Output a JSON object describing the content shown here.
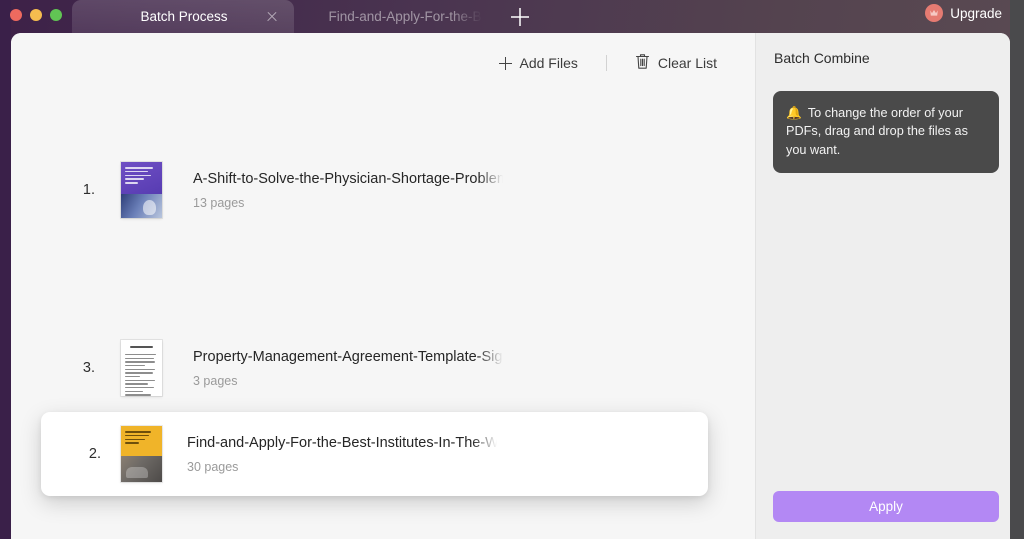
{
  "window": {
    "traffic_lights": [
      "close",
      "minimize",
      "zoom"
    ],
    "accent_purple": "#b388f4",
    "rail_purple": "#3a2049"
  },
  "tabs": [
    {
      "label": "Batch Process",
      "active": true,
      "closable": true
    },
    {
      "label": "Find-and-Apply-For-the-B",
      "active": false,
      "closable": false
    }
  ],
  "new_tab_label": "+",
  "upgrade": {
    "label": "Upgrade",
    "badge_color": "#e57b72"
  },
  "toolbar": {
    "add_files_label": "Add Files",
    "clear_list_label": "Clear List"
  },
  "files": [
    {
      "index": "1.",
      "name": "A-Shift-to-Solve-the-Physician-Shortage-Problem-ar",
      "pages": "13 pages",
      "thumb": "purple-research-cover",
      "dragging": false
    },
    {
      "index": "3.",
      "name": "Property-Management-Agreement-Template-Signatur",
      "pages": "3 pages",
      "thumb": "white-document-cover",
      "dragging": false
    },
    {
      "index": "2.",
      "name": "Find-and-Apply-For-the-Best-Institutes-In-The-World",
      "pages": "30 pages",
      "thumb": "yellow-institutes-cover",
      "dragging": true
    }
  ],
  "side_panel": {
    "title": "Batch Combine",
    "tip_icon": "🔔",
    "tip_text": "To change the order of your PDFs, drag and drop the files as you want.",
    "apply_label": "Apply"
  }
}
